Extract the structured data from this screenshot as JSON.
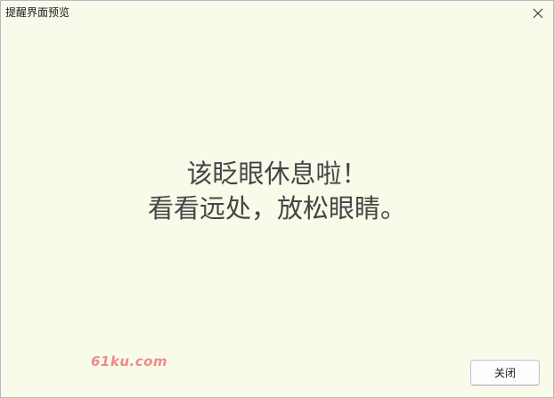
{
  "window": {
    "title": "提醒界面预览"
  },
  "message": {
    "line1": "该眨眼休息啦！",
    "line2": "看看远处，放松眼睛。"
  },
  "watermark": {
    "text": "61ku.com"
  },
  "buttons": {
    "close_label": "关闭"
  },
  "icons": {
    "window_close": "close-icon"
  },
  "colors": {
    "background": "#f9fbea",
    "message_text": "#454545",
    "watermark": "#f08a8a"
  }
}
